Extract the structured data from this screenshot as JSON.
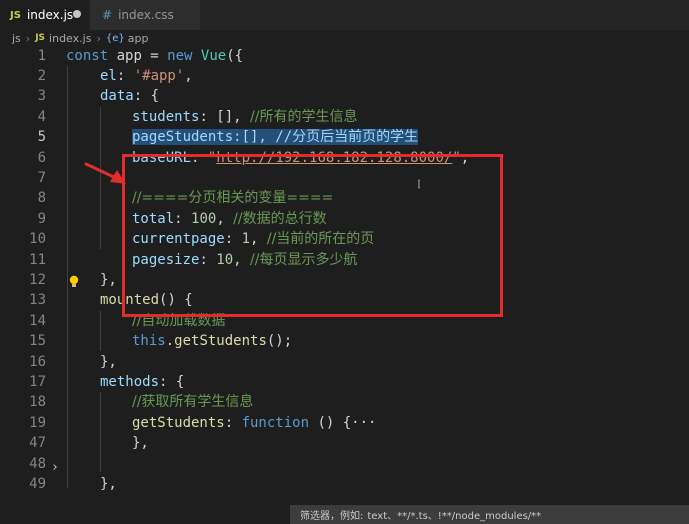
{
  "tabs": [
    {
      "icon": "JS",
      "label": "index.js",
      "modified": true
    },
    {
      "icon": "#",
      "label": "index.css"
    }
  ],
  "breadcrumb": {
    "folder": "js",
    "file_icon": "JS",
    "file": "index.js",
    "symbol_icon": "{e}",
    "symbol": "app"
  },
  "line_numbers": [
    "1",
    "2",
    "3",
    "4",
    "5",
    "6",
    "7",
    "8",
    "9",
    "10",
    "11",
    "12",
    "13",
    "14",
    "15",
    "16",
    "17",
    "18",
    "19",
    "47",
    "48",
    "49"
  ],
  "current_line": "5",
  "code": {
    "l1": {
      "kw": "const",
      "name": " app = ",
      "new": "new",
      "cls": " Vue",
      "rest": "({"
    },
    "l2": {
      "prop": "el",
      "pun": ": ",
      "str": "'#app'",
      "end": ","
    },
    "l3": {
      "prop": "data",
      "pun": ": {"
    },
    "l4": {
      "prop": "students",
      "pun": ": [], ",
      "cmt": "//所有的学生信息"
    },
    "l5": {
      "sel": "pageStudents:[], //分页后当前页的学生",
      "rest": "生"
    },
    "l6": {
      "prop": "baseURL",
      "pun": ": ",
      "q1": "\"",
      "url": "http://192.168.182.128:8000/",
      "q2": "\"",
      "end": ","
    },
    "l8": {
      "cmt": "//====分页相关的变量===="
    },
    "l9": {
      "prop": "total",
      "pun": ": ",
      "num": "100",
      "end": ", ",
      "cmt": "//数据的总行数"
    },
    "l10": {
      "prop": "currentpage",
      "pun": ": ",
      "num": "1",
      "end": ", ",
      "cmt": "//当前的所在的页"
    },
    "l11": {
      "prop": "pagesize",
      "pun": ": ",
      "num": "10",
      "end": ", ",
      "cmt": "//每页显示多少航"
    },
    "l12": {
      "pun": "},"
    },
    "l13": {
      "fn": "mounted",
      "pun": "() {"
    },
    "l14": {
      "cmt": "//自动加载数据"
    },
    "l15": {
      "kw": "this",
      "pun": ".",
      "fn": "getStudents",
      "end": "();"
    },
    "l16": {
      "pun": "},"
    },
    "l17": {
      "prop": "methods",
      "pun": ": {"
    },
    "l18": {
      "cmt": "//获取所有学生信息"
    },
    "l19": {
      "fn": "getStudents",
      "pun": ": ",
      "kw": "function",
      "end": " () {",
      "ellipsis": "···"
    },
    "l47": {
      "pun": "},"
    },
    "l49": {
      "pun": "},"
    }
  },
  "status": {
    "label": "筛选器，例如:",
    "value": "text、**/*.ts、!**/node_modules/**"
  },
  "colors": {
    "annotation": "#e32d2d",
    "selection": "#264f78"
  }
}
